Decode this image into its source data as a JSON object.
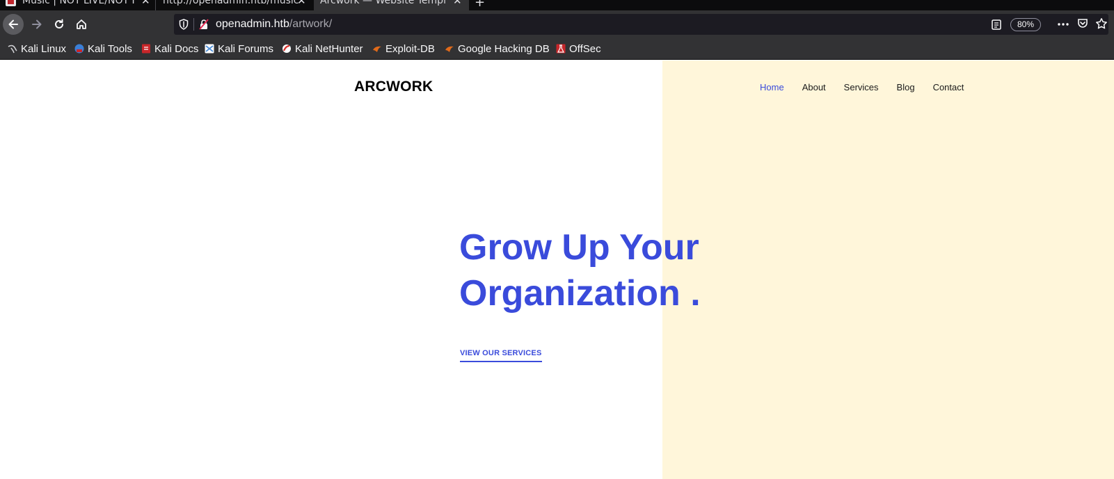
{
  "browser": {
    "tabs": [
      {
        "title": "Music | NOT LIVE/NOT F",
        "active": false
      },
      {
        "title": "http://openadmin.htb/music",
        "active": false
      },
      {
        "title": "Arcwork — Website Templ",
        "active": true
      }
    ],
    "new_tab_symbol": "+",
    "close_symbol": "✕",
    "url": {
      "host": "openadmin.htb",
      "path": "/artwork/"
    },
    "zoom": "80%",
    "icons": [
      "back-arrow-icon",
      "forward-arrow-icon",
      "reload-icon",
      "home-icon",
      "shield-icon",
      "insecure-lock-icon",
      "reader-view-icon",
      "more-dots-icon",
      "pocket-icon",
      "star-bookmark-icon"
    ],
    "bookmarks": [
      {
        "label": "Kali Linux",
        "color": "#d0d0d4"
      },
      {
        "label": "Kali Tools",
        "color": "#3b7fd6"
      },
      {
        "label": "Kali Docs",
        "color": "#c8262a"
      },
      {
        "label": "Kali Forums",
        "color": "#4f8fd8"
      },
      {
        "label": "Kali NetHunter",
        "color": "#d8322e"
      },
      {
        "label": "Exploit-DB",
        "color": "#e06a1a"
      },
      {
        "label": "Google Hacking DB",
        "color": "#e06a1a"
      },
      {
        "label": "OffSec",
        "color": "#c8262a"
      }
    ]
  },
  "site": {
    "logo": "ARCWORK",
    "nav": [
      "Home",
      "About",
      "Services",
      "Blog",
      "Contact"
    ],
    "hero_line1": "Grow Up Your",
    "hero_line2": "Organization .",
    "cta": "VIEW OUR SERVICES",
    "accent_color": "#3a4bdb",
    "panel_color": "#fff6da"
  }
}
